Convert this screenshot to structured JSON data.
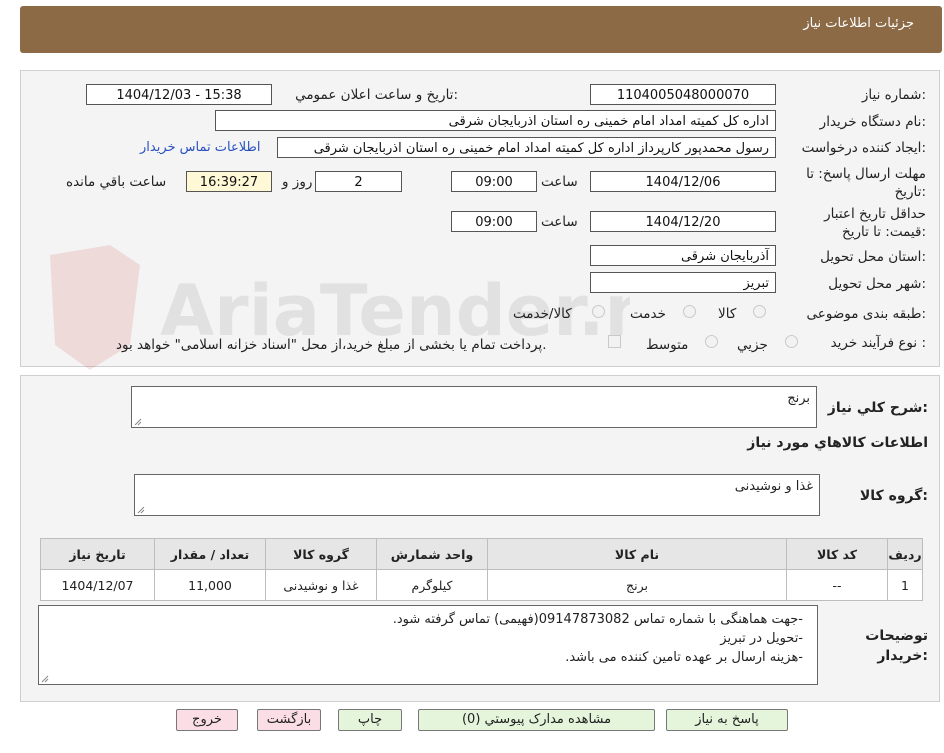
{
  "header": {
    "title": "جزئیات اطلاعات نیاز"
  },
  "watermark": {
    "text": "AriaTender.net"
  },
  "form": {
    "need_number_label": "شماره نیاز:",
    "need_number": "1104005048000070",
    "announce_label": "تاریخ و ساعت اعلان عمومي:",
    "announce_value": "1404/12/03 - 15:38",
    "buyer_label": "نام دستگاه خريدار:",
    "buyer_value": "اداره کل کمیته امداد امام خمینی  ره  استان اذربایجان شرقی",
    "requester_label": "ايجاد کننده درخواست:",
    "requester_value": "رسول محمدپور کارپرداز اداره کل کمیته امداد امام خمینی  ره  استان اذربایجان شرقی",
    "contact_link": "اطلاعات تماس خریدار",
    "deadline_label": "مهلت ارسال پاسخ: تا تاریخ:",
    "deadline_date": "1404/12/06",
    "time_label": "ساعت",
    "deadline_time": "09:00",
    "days_value": "2",
    "days_label": "روز و",
    "remaining_time": "16:39:27",
    "remaining_label": "ساعت باقي مانده",
    "validity_label": "حداقل تاریخ اعتبار قیمت: تا تاریخ:",
    "validity_date": "1404/12/20",
    "validity_time": "09:00",
    "province_label": "استان محل تحویل:",
    "province_value": "آذربایجان شرقی",
    "city_label": "شهر محل تحویل:",
    "city_value": "تبریز",
    "category_label": "طبقه بندی موضوعی:",
    "category_options": [
      "کالا",
      "خدمت",
      "کالا/خدمت"
    ],
    "process_label": "نوع فرآیند خرید :",
    "process_options": [
      "جزیي",
      "متوسط"
    ],
    "payment_note": "پرداخت تمام یا بخشی از مبلغ خرید،از محل \"اسناد خزانه اسلامی\" خواهد بود."
  },
  "summary": {
    "desc_label": "شرح كلي نياز:",
    "desc_value": "برنج",
    "goods_info_title": "اطلاعات كالاهاي مورد نياز",
    "group_label": "گروه كالا:",
    "group_value": "غذا و نوشیدنی"
  },
  "table": {
    "headers": [
      "رديف",
      "کد کالا",
      "نام کالا",
      "واحد شمارش",
      "گروه کالا",
      "تعداد / مقدار",
      "تاریخ نیاز"
    ],
    "rows": [
      [
        "1",
        "--",
        "برنج",
        "کیلوگرم",
        "غذا و نوشیدنی",
        "11,000",
        "1404/12/07"
      ]
    ]
  },
  "notes": {
    "label": "توضیحات خریدار:",
    "lines": [
      "-جهت هماهنگی با شماره تماس 09147873082(فهیمی) تماس گرفته شود.",
      "-تحویل در تبریز",
      "-هزینه ارسال بر عهده تامین کننده می باشد."
    ]
  },
  "buttons": {
    "reply": "پاسخ به نیاز",
    "docs": "مشاهده مدارک پیوستي (0)",
    "print": "چاپ",
    "back": "بازگشت",
    "exit": "خروج"
  }
}
